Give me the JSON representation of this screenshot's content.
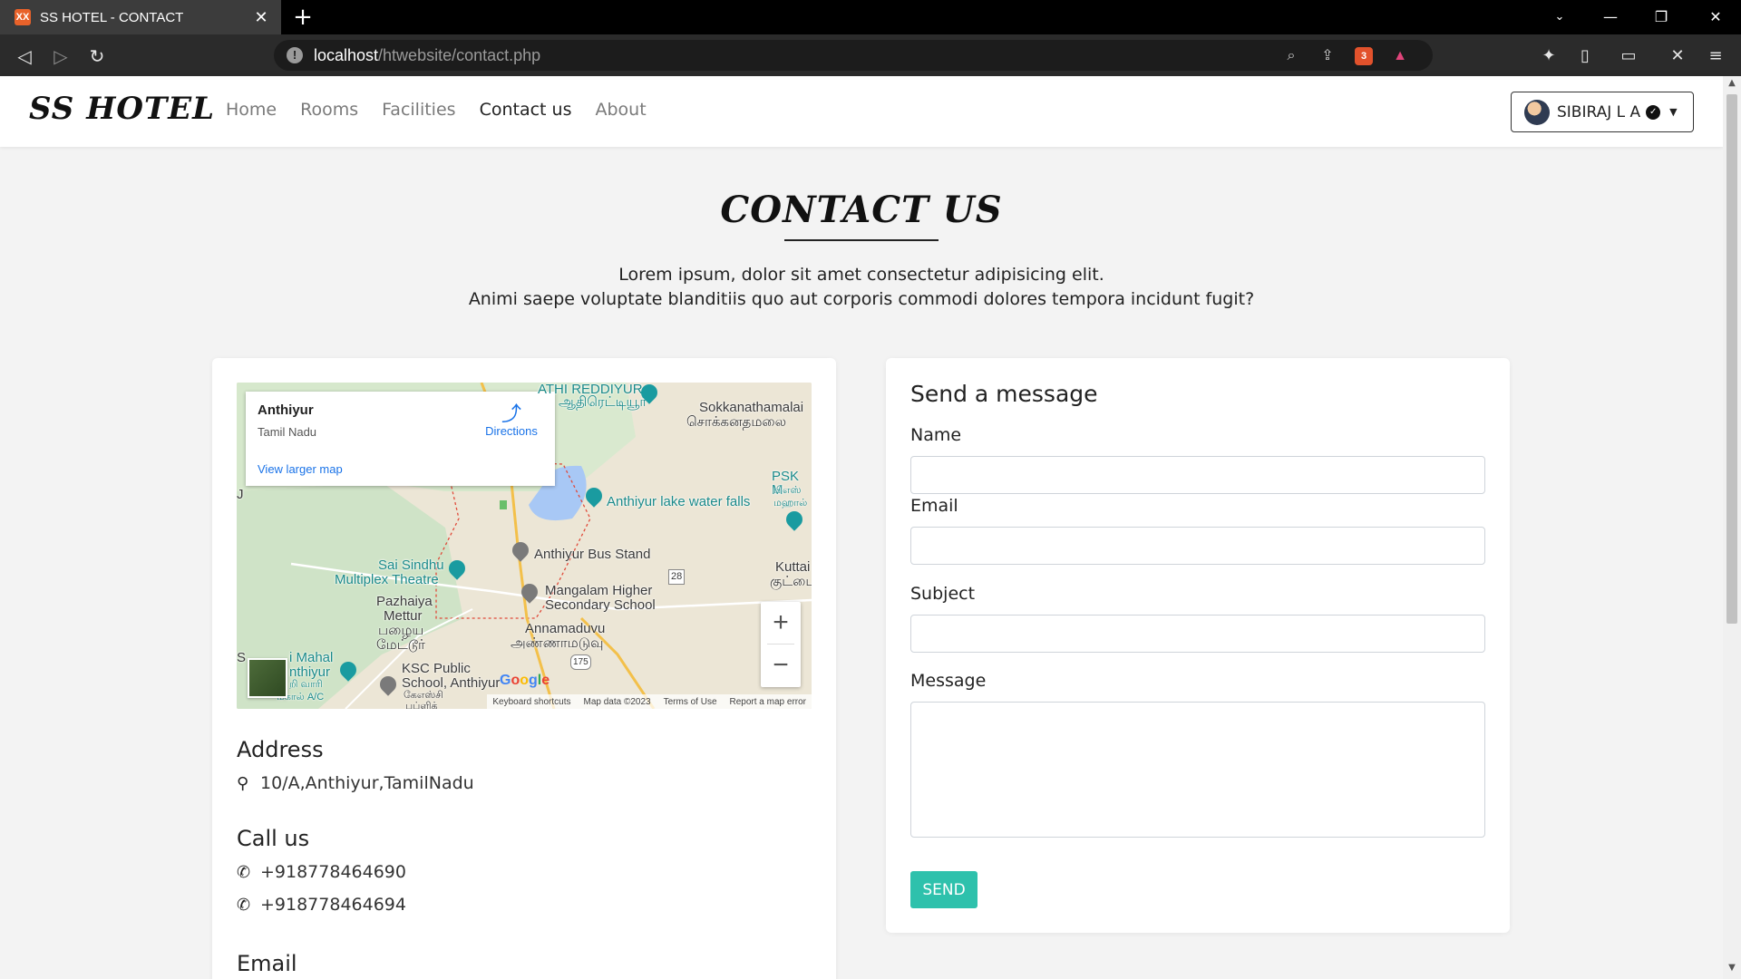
{
  "browser": {
    "tab_title": "SS HOTEL - CONTACT",
    "favicon_text": "XX",
    "url_host": "localhost",
    "url_path": "/htwebsite/contact.php",
    "brave_badge": "3"
  },
  "navbar": {
    "brand": "SS HOTEL",
    "links": [
      "Home",
      "Rooms",
      "Facilities",
      "Contact us",
      "About"
    ],
    "active_link": "Contact us",
    "user_name": "SIBIRAJ L A"
  },
  "page": {
    "title": "CONTACT US",
    "intro_line1": "Lorem ipsum, dolor sit amet consectetur adipisicing elit.",
    "intro_line2": "Animi saepe voluptate blanditiis quo aut corporis commodi dolores tempora incidunt fugit?"
  },
  "map": {
    "place": "Anthiyur",
    "region": "Tamil Nadu",
    "directions": "Directions",
    "view_larger": "View larger map",
    "labels": {
      "athi": "ATHI REDDIYUR",
      "athi_ta": "ஆதிரெட்டியூர்",
      "sokka": "Sokkanathamalai",
      "sokka_ta": "சொக்கனதமலை",
      "psk": "PSK M",
      "psk_ta1": "பிஎஸ்",
      "psk_ta2": "மஹால்",
      "lake": "Anthiyur lake water falls",
      "bus": "Anthiyur Bus Stand",
      "sai1": "Sai Sindhu",
      "sai2": "Multiplex Theatre",
      "school1": "Mangalam Higher",
      "school2": "Secondary School",
      "road": "28",
      "kuttai": "Kuttai",
      "kuttai_ta": "குட்டை",
      "pazh1": "Pazhaiya",
      "pazh2": "Mettur",
      "pazh_ta1": "பழைய",
      "pazh_ta2": "மேட்டூர்",
      "anna": "Annamaduvu",
      "anna_ta": "அண்ணாமடுவு",
      "mahal1": "i Mahal",
      "mahal2": "nthiyur",
      "mahal_ta1": "றி வாரி",
      "mahal_ta2": "மகால் A/C",
      "ksc1": "KSC Public",
      "ksc2": "School, Anthiyur",
      "ksc_ta": "கேஎஸ்சி",
      "ksc_ta2": "பப்ளிக்",
      "hwy": "175",
      "edge_s": "S",
      "edge_j": "J"
    },
    "google": "Google",
    "footer": [
      "Keyboard shortcuts",
      "Map data ©2023",
      "Terms of Use",
      "Report a map error"
    ],
    "zoom_in": "+",
    "zoom_out": "−"
  },
  "contact": {
    "address_heading": "Address",
    "address": "10/A,Anthiyur,TamilNadu",
    "call_heading": "Call us",
    "phone1": "+918778464690",
    "phone2": "+918778464694",
    "email_heading": "Email"
  },
  "form": {
    "title": "Send a message",
    "name_label": "Name",
    "email_label": "Email",
    "subject_label": "Subject",
    "message_label": "Message",
    "send_label": "SEND"
  },
  "colors": {
    "accent": "#2ec1ac",
    "page_bg": "#f3f3f3",
    "link_blue": "#1a73e8"
  }
}
